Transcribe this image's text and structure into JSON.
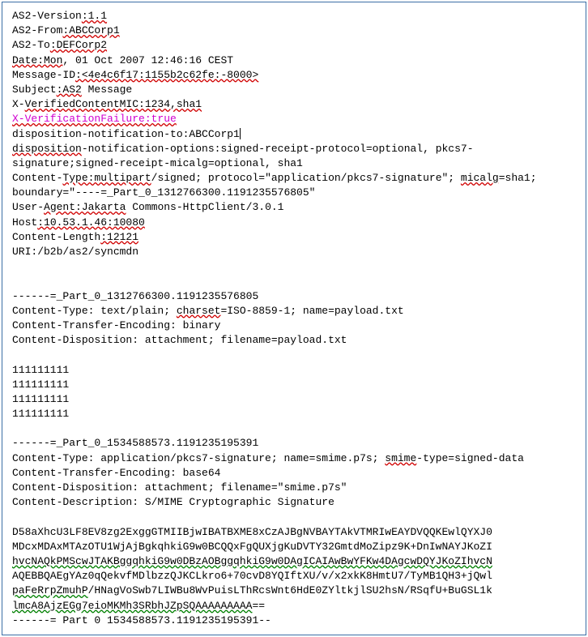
{
  "h": {
    "as2v_k": "AS2-Version",
    "as2v_v": ":1.1",
    "as2from_k": "AS2-From",
    "as2from_v": ":ABCCorp1",
    "as2to_k": "AS2-To",
    "as2to_v": ":DEFCorp2",
    "date_ku": "Date:Mon",
    "date_rest": ", 01 Oct 2007 12:46:16 CEST",
    "msgid_k": "Message-ID",
    "msgid_v": ":<4e4c6f17:1155b2c62fe:-8000>",
    "subj_k": "Subject",
    "subj_vu": ":AS2",
    "subj_rest": " Message",
    "xvcm_k": "X-",
    "xvcm_u": "VerifiedContentMIC:1234,sha1",
    "xvf_full": "X-VerificationFailure:true",
    "dispnot_to_k": "disposition-notification-to:ABCCorp1",
    "dispopt_u": "disposition",
    "dispopt_rest": "-notification-options:signed-receipt-protocol=optional, pkcs7-signature;signed-receipt-micalg=optional, sha1",
    "ct_k": "Content-",
    "ct_u": "Type:multipart",
    "ct_rest": "/signed; protocol=\"application/pkcs7-signature\"; ",
    "micalg_u": "micalg",
    "micalg_rest": "=sha1; boundary=\"----=_Part_0_1312766300.1191235576805\"",
    "ua_k": "User-",
    "ua_u": "Agent:Jakarta",
    "ua_rest": " Commons-HttpClient/3.0.1",
    "host_k": "Host",
    "host_v": ":10.53.1.46:10080",
    "clen_k": "Content-Length",
    "clen_v": ":12121",
    "uri": "URI:/b2b/as2/syncmdn"
  },
  "p1": {
    "boundary": "------=_Part_0_1312766300.1191235576805",
    "ct_pre": "Content-Type: text/plain; ",
    "ct_u": "charset",
    "ct_post": "=ISO-8859-1; name=payload.txt",
    "cte": "Content-Transfer-Encoding: binary",
    "cd": "Content-Disposition: attachment; filename=payload.txt",
    "body1": "111111111",
    "body2": "111111111",
    "body3": "111111111",
    "body4": "111111111"
  },
  "p2": {
    "boundary": "------=_Part_0_1534588573.1191235195391",
    "ct_pre": "Content-Type: application/pkcs7-signature; name=smime.p7s; ",
    "ct_u": "smime",
    "ct_post": "-type=signed-data",
    "cte": "Content-Transfer-Encoding: base64",
    "cd": "Content-Disposition: attachment; filename=\"smime.p7s\"",
    "cdesc": "Content-Description: S/MIME Cryptographic Signature",
    "b64_l1": "D58aXhcU3LF8EV8zg2ExggGTMIIBjwIBATBXME8xCzAJBgNVBAYTAkVTMRIwEAYDVQQKEwlQYXJ0",
    "b64_l2": "MDcxMDAxMTAzOTU1WjAjBgkqhkiG9w0BCQQxFgQUXjgKuDVTY32GmtdMoZipz9K+DnIwNAYJKoZI",
    "b64_l3u": "hvcNAQkPMScwJTAKBggqhkiG9w0DBzAOBggqhkiG9w0DAgICAIAwBwYFKw4DAgcwDQYJKoZIhvcN",
    "b64_l4a": "AQEBBQAEgYAz0qQekvfMDlbzzQJKCLkro6+70cvD8YQIftXU/v/x2xkK8HmtU7/TyMB1QH3+jQwl",
    "b64_l5u1": "paFeRrpZmuhP",
    "b64_l5mid": "/HNagVoSwb7LIWBu8WvPuisLThRcsWnt6HdE0ZYltkjlSU2hsN/RSqfU+BuGSL1k",
    "b64_l6u": "lmcA8AjzEGg7eioMKMh3SRbhJZpSQAAAAAAAAA",
    "b64_l6end": "==",
    "end": "------= Part 0 1534588573.1191235195391--"
  }
}
